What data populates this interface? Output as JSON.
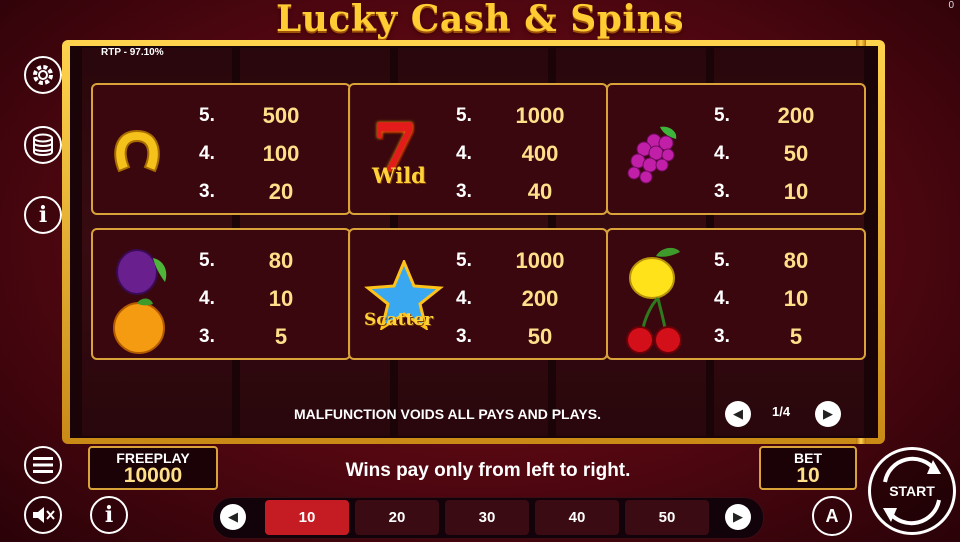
{
  "title": "Lucky Cash & Spins",
  "corner_counter": "0",
  "rtp": "RTP - 97.10%",
  "paytable": [
    {
      "symbol": "horseshoe",
      "rows": [
        {
          "count": "5.",
          "pay": "500"
        },
        {
          "count": "4.",
          "pay": "100"
        },
        {
          "count": "3.",
          "pay": "20"
        }
      ]
    },
    {
      "symbol": "seven-wild",
      "label": "Wild",
      "glyph": "7",
      "rows": [
        {
          "count": "5.",
          "pay": "1000"
        },
        {
          "count": "4.",
          "pay": "400"
        },
        {
          "count": "3.",
          "pay": "40"
        }
      ]
    },
    {
      "symbol": "grapes",
      "rows": [
        {
          "count": "5.",
          "pay": "200"
        },
        {
          "count": "4.",
          "pay": "50"
        },
        {
          "count": "3.",
          "pay": "10"
        }
      ]
    },
    {
      "symbol": "plum-orange",
      "rows": [
        {
          "count": "5.",
          "pay": "80"
        },
        {
          "count": "4.",
          "pay": "10"
        },
        {
          "count": "3.",
          "pay": "5"
        }
      ]
    },
    {
      "symbol": "star-scatter",
      "label": "Scatter",
      "rows": [
        {
          "count": "5.",
          "pay": "1000"
        },
        {
          "count": "4.",
          "pay": "200"
        },
        {
          "count": "3.",
          "pay": "50"
        }
      ]
    },
    {
      "symbol": "lemon-cherries",
      "rows": [
        {
          "count": "5.",
          "pay": "80"
        },
        {
          "count": "4.",
          "pay": "10"
        },
        {
          "count": "3.",
          "pay": "5"
        }
      ]
    }
  ],
  "disclaimer": "MALFUNCTION VOIDS ALL PAYS AND PLAYS.",
  "page_indicator": "1/4",
  "freeplay": {
    "label": "FREEPLAY",
    "value": "10000"
  },
  "wins_note": "Wins pay only from left to right.",
  "bet": {
    "label": "BET",
    "value": "10"
  },
  "bet_options": [
    "10",
    "20",
    "30",
    "40",
    "50"
  ],
  "selected_bet": "10",
  "start_label": "START",
  "auto_label": "A",
  "colors": {
    "accent_gold": "#ffcc33",
    "active_bet": "#c41c22",
    "background": "#5a0812"
  }
}
